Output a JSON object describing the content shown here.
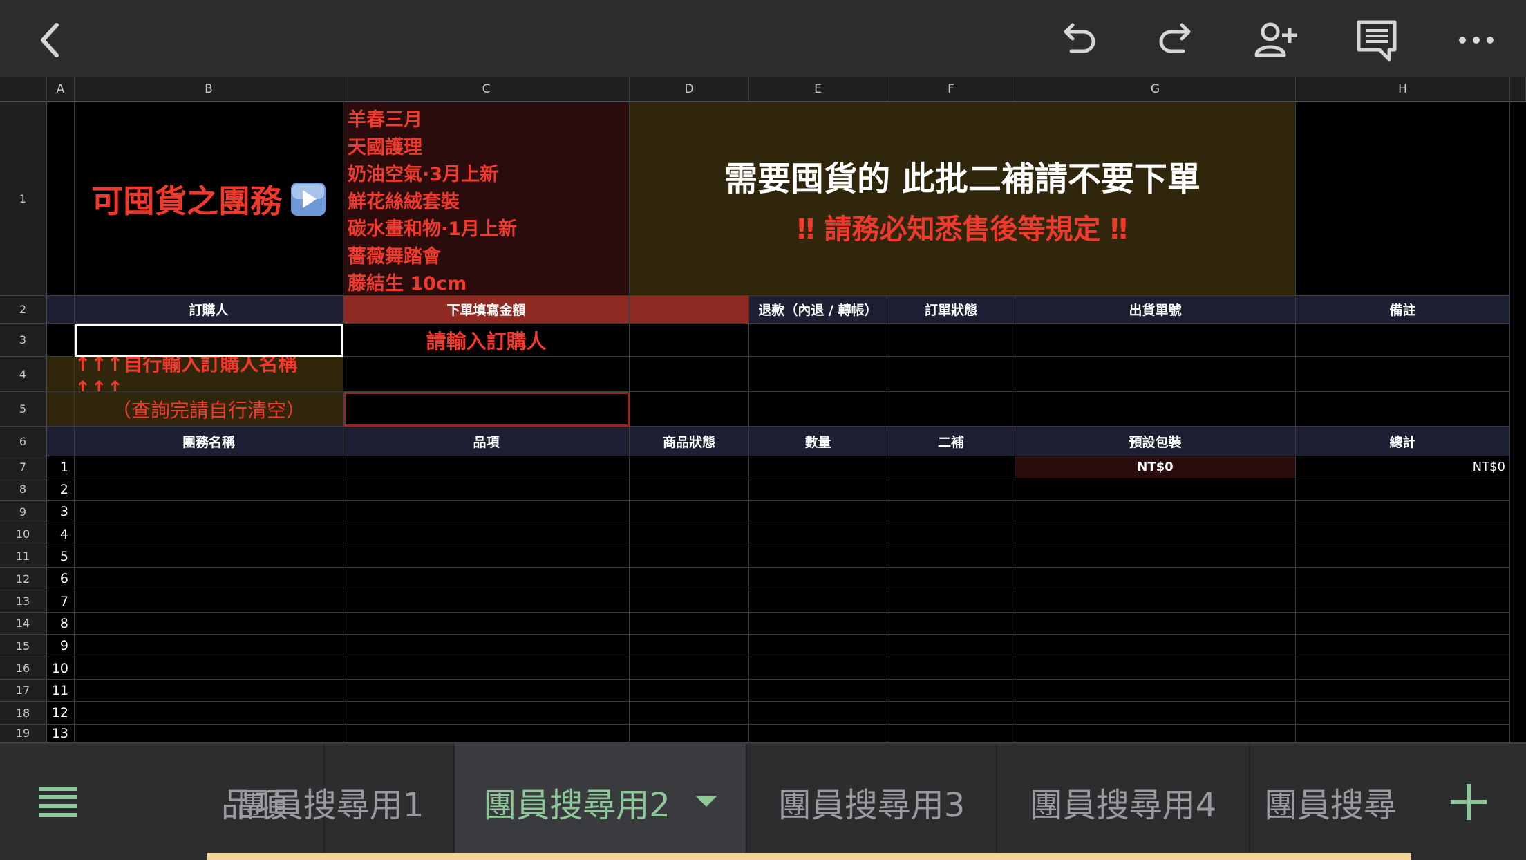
{
  "columns": [
    "A",
    "B",
    "C",
    "D",
    "E",
    "F",
    "G",
    "H"
  ],
  "rows": [
    "1",
    "2",
    "3",
    "4",
    "5",
    "6",
    "7",
    "8",
    "9",
    "10",
    "11",
    "12",
    "13",
    "14",
    "15",
    "16",
    "17",
    "18",
    "19"
  ],
  "banner": {
    "title": "可囤貨之團務",
    "title_icon": "play-button-icon",
    "list": [
      "羊春三月",
      "天國護理",
      "奶油空氣·3月上新",
      "鮮花絲絨套裝",
      "碳水畫和物·1月上新",
      "薔薇舞踏會",
      "藤結生 10cm"
    ],
    "notice_main": "需要囤貨的 此批二補請不要下單",
    "notice_sub": "‼ 請務必知悉售後等規定 ‼"
  },
  "order_header": {
    "buyer": "訂購人",
    "amount": "下單填寫金額",
    "refund": "退款（內退 / 轉帳）",
    "order_status": "訂單狀態",
    "shipping_no": "出貨單號",
    "remarks": "備註"
  },
  "prompt": "請輸入訂購人",
  "instruction_1": "↑↑↑自行輸入訂購人名稱↑↑↑",
  "instruction_2": "（查詢完請自行清空）",
  "item_header": {
    "group_name": "團務名稱",
    "item": "品項",
    "product_status": "商品狀態",
    "quantity": "數量",
    "second_restock": "二補",
    "default_packaging": "預設包裝",
    "total": "總計"
  },
  "line_numbers": [
    "1",
    "2",
    "3",
    "4",
    "5",
    "6",
    "7",
    "8",
    "9",
    "10",
    "11",
    "12",
    "13"
  ],
  "packaging_value": "NT$0",
  "total_value": "NT$0",
  "sheet_tabs": [
    "品項",
    "團員搜尋用1",
    "團員搜尋用2",
    "團員搜尋用3",
    "團員搜尋用4",
    "團員搜尋"
  ],
  "active_tab_index": 2,
  "colors": {
    "accent_green": "#8fc79a",
    "alert_red": "#f0392b",
    "header_bg": "#1d1f33"
  }
}
